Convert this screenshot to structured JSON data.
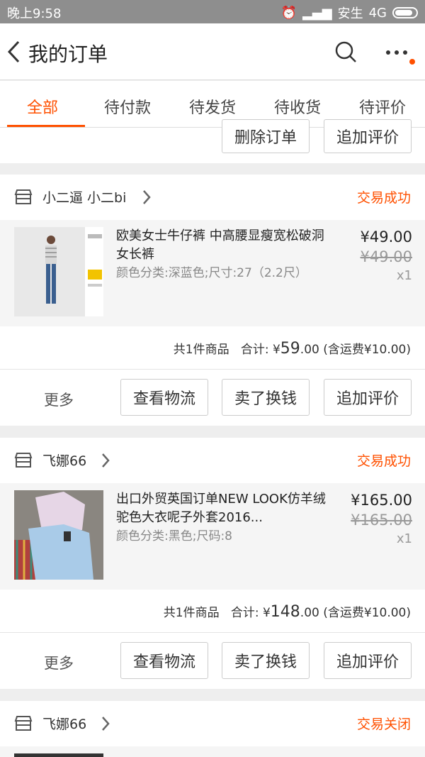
{
  "status_bar": {
    "time": "晚上9:58",
    "carrier": "安生",
    "network": "4G"
  },
  "header": {
    "title": "我的订单"
  },
  "tabs": [
    "全部",
    "待付款",
    "待发货",
    "待收货",
    "待评价"
  ],
  "partial_card": {
    "buttons": [
      "删除订单",
      "追加评价"
    ]
  },
  "orders": [
    {
      "shop": "小二逼 小二bi",
      "status": "交易成功",
      "title": "欧美女士牛仔裤 中高腰显瘦宽松破洞女长裤",
      "spec": "颜色分类:深蓝色;尺寸:27（2.2尺）",
      "price": "¥49.00",
      "old_price": "¥49.00",
      "qty": "x1",
      "count_text": "共1件商品",
      "total_label": "合计: ¥",
      "total_int": "59",
      "total_dec": ".00",
      "shipping": "(含运费¥10.00)",
      "more": "更多",
      "buttons": [
        "查看物流",
        "卖了换钱",
        "追加评价"
      ]
    },
    {
      "shop": "飞娜66",
      "status": "交易成功",
      "title": "出口外贸英国订单NEW LOOK仿羊绒驼色大衣呢子外套2016...",
      "spec": "颜色分类:黑色;尺码:8",
      "price": "¥165.00",
      "old_price": "¥165.00",
      "qty": "x1",
      "count_text": "共1件商品",
      "total_label": "合计: ¥",
      "total_int": "148",
      "total_dec": ".00",
      "shipping": "(含运费¥10.00)",
      "more": "更多",
      "buttons": [
        "查看物流",
        "卖了换钱",
        "追加评价"
      ]
    },
    {
      "shop": "飞娜66",
      "status": "交易关闭"
    }
  ],
  "colors": {
    "accent": "#ff5000",
    "statusbar": "#8e8e8e",
    "background": "#eeeeee"
  },
  "icons": [
    "back-arrow-icon",
    "search-icon",
    "more-dots-icon",
    "shop-icon",
    "chevron-right-icon"
  ]
}
